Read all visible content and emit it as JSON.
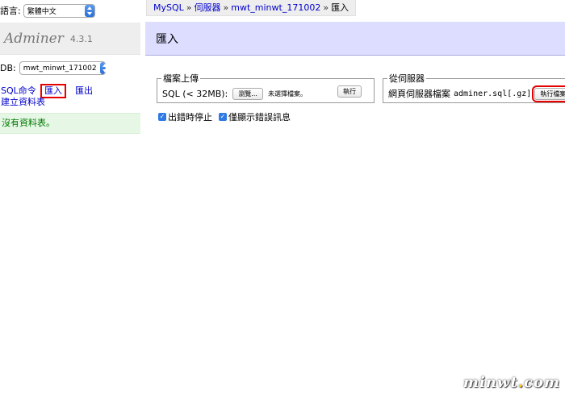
{
  "sidebar": {
    "language_label": "語言:",
    "language_value": "繁體中文",
    "brand_name": "Adminer",
    "brand_version": "4.3.1",
    "db_label": "DB:",
    "db_value": "mwt_minwt_171002",
    "links": {
      "sql": "SQL命令",
      "import": "匯入",
      "export": "匯出",
      "create_table": "建立資料表"
    },
    "no_tables_message": "沒有資料表。"
  },
  "breadcrumb": {
    "items": [
      "MySQL",
      "伺服器",
      "mwt_minwt_171002"
    ],
    "separator": "»",
    "current": "匯入"
  },
  "main": {
    "title": "匯入",
    "upload": {
      "legend": "檔案上傳",
      "label": "SQL (< 32MB):",
      "choose_button": "瀏覽...",
      "no_file_text": "未選擇檔案。",
      "exec_button": "執行"
    },
    "server": {
      "legend": "從伺服器",
      "label": "網頁伺服器檔案",
      "file_name": "adminer.sql[.gz]",
      "exec_button": "執行檔案"
    },
    "options": {
      "stop_on_error": "出錯時停止",
      "only_errors": "僅顯示錯誤訊息"
    }
  },
  "watermark": "minwt.com",
  "colors": {
    "link": "#0000cc",
    "title_bar": "#ddddff",
    "highlight": "#e60000",
    "message_bg": "#e6f7e6",
    "message_text": "#007700"
  }
}
